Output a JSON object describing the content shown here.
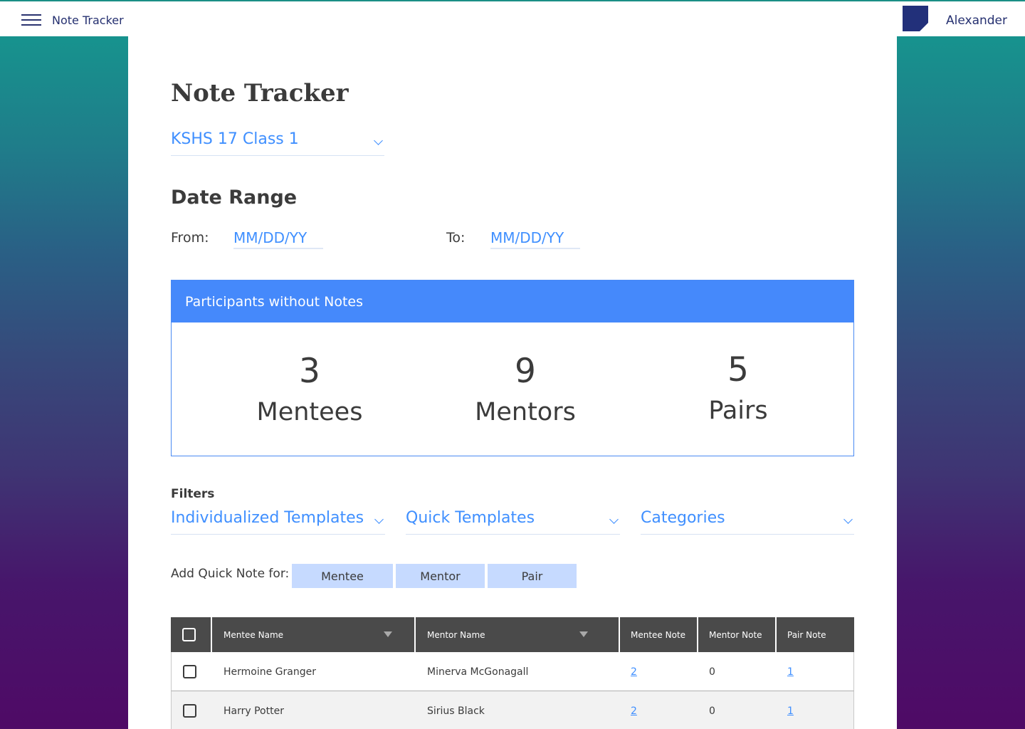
{
  "header": {
    "app_name": "Note Tracker",
    "user_name": "Alexander"
  },
  "page": {
    "title": "Note Tracker",
    "class_select": "KSHS 17 Class 1",
    "date_range": {
      "heading": "Date Range",
      "from_label": "From:",
      "from_placeholder": "MM/DD/YY",
      "to_label": "To:",
      "to_placeholder": "MM/DD/YY"
    },
    "participants_panel": {
      "header": "Participants without Notes",
      "stats": [
        {
          "value": "3",
          "label": "Mentees"
        },
        {
          "value": "9",
          "label": "Mentors"
        },
        {
          "value": "5",
          "label": "Pairs"
        }
      ]
    },
    "filters": {
      "label": "Filters",
      "items": [
        "Individualized Templates",
        "Quick Templates",
        "Categories"
      ]
    },
    "quick_note": {
      "label": "Add Quick Note for:",
      "buttons": [
        "Mentee",
        "Mentor",
        "Pair"
      ]
    },
    "table": {
      "columns": [
        "Mentee Name",
        "Mentor Name",
        "Mentee Note",
        "Mentor Note",
        "Pair Note"
      ],
      "rows": [
        {
          "mentee": "Hermoine Granger",
          "mentor": "Minerva McGonagall",
          "mentee_note": "2",
          "mentor_note": "0",
          "pair_note": "1"
        },
        {
          "mentee": "Harry Potter",
          "mentor": "Sirius Black",
          "mentee_note": "2",
          "mentor_note": "0",
          "pair_note": "1"
        }
      ]
    }
  },
  "colors": {
    "accent": "#4589fb",
    "link": "#3f8fff",
    "nav_text": "#253070",
    "table_header": "#4a4a4a",
    "quick_button": "#c6daff"
  }
}
